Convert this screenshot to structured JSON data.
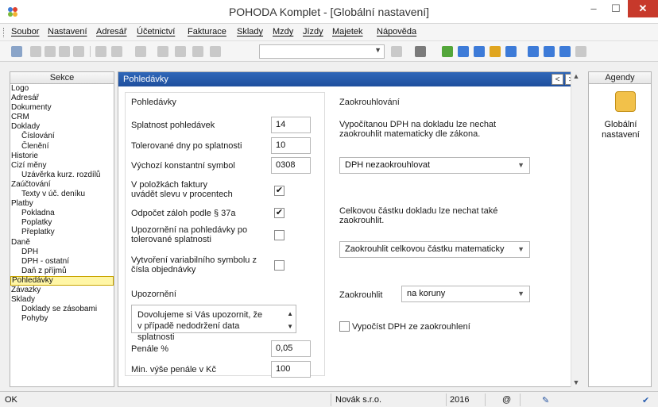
{
  "window": {
    "title": "POHODA Komplet - [Globální nastavení]",
    "minimize": "–",
    "maximize": "☐",
    "close": "✕"
  },
  "menu": [
    "Soubor",
    "Nastavení",
    "Adresář",
    "Účetnictví",
    "Fakturace",
    "Sklady",
    "Mzdy",
    "Jízdy",
    "Majetek",
    "Nápověda"
  ],
  "sections": {
    "header": "Sekce",
    "items": [
      {
        "label": "Logo",
        "level": 1
      },
      {
        "label": "Adresář",
        "level": 1
      },
      {
        "label": "Dokumenty",
        "level": 1
      },
      {
        "label": "CRM",
        "level": 1
      },
      {
        "label": "Doklady",
        "level": 1
      },
      {
        "label": "Číslování",
        "level": 2
      },
      {
        "label": "Členění",
        "level": 2
      },
      {
        "label": "Historie",
        "level": 1
      },
      {
        "label": "Cizí měny",
        "level": 1
      },
      {
        "label": "Uzávěrka kurz. rozdílů",
        "level": 2
      },
      {
        "label": "Zaúčtování",
        "level": 1
      },
      {
        "label": "Texty v úč. deníku",
        "level": 2
      },
      {
        "label": "Platby",
        "level": 1
      },
      {
        "label": "Pokladna",
        "level": 2
      },
      {
        "label": "Poplatky",
        "level": 2
      },
      {
        "label": "Přeplatky",
        "level": 2
      },
      {
        "label": "Daně",
        "level": 1
      },
      {
        "label": "DPH",
        "level": 2
      },
      {
        "label": "DPH - ostatní",
        "level": 2
      },
      {
        "label": "Daň z příjmů",
        "level": 2
      },
      {
        "label": "Pohledávky",
        "level": 1,
        "selected": true
      },
      {
        "label": "Závazky",
        "level": 1
      },
      {
        "label": "Sklady",
        "level": 1
      },
      {
        "label": "Doklady se zásobami",
        "level": 2
      },
      {
        "label": "Pohyby",
        "level": 2
      }
    ]
  },
  "main": {
    "header": "Pohledávky",
    "nav_prev": "<",
    "nav_next": ">",
    "receivables": {
      "title": "Pohledávky",
      "due_label": "Splatnost pohledávek",
      "due_value": "14",
      "tolerance_label": "Tolerované dny po splatnosti",
      "tolerance_value": "10",
      "const_symbol_label": "Výchozí konstantní symbol",
      "const_symbol_value": "0308",
      "discount_pct_label_1": "V položkách faktury",
      "discount_pct_label_2": "uvádět slevu v procentech",
      "discount_pct_checked": "✔",
      "advance_label": "Odpočet záloh podle § 37a",
      "advance_checked": "✔",
      "notify_label_1": "Upozornění na pohledávky po",
      "notify_label_2": "tolerované splatnosti",
      "notify_checked": "",
      "varsym_label_1": "Vytvoření variabilního symbolu z",
      "varsym_label_2": "čísla objednávky",
      "varsym_checked": ""
    },
    "notice": {
      "title": "Upozornění",
      "text_1": "Dovolujeme si Vás upozornit, že",
      "text_2": "v případě nedodržení data splatnosti",
      "penalty_label": "Penále %",
      "penalty_value": "0,05",
      "min_penalty_label": "Min. výše penále v Kč",
      "min_penalty_value": "100"
    },
    "rounding": {
      "title": "Zaokrouhlování",
      "vat_desc_1": "Vypočítanou DPH na dokladu lze nechat",
      "vat_desc_2": "zaokrouhlit matematicky dle zákona.",
      "vat_select": "DPH nezaokrouhlovat",
      "total_desc_1": "Celkovou částku dokladu lze nechat také",
      "total_desc_2": "zaokrouhlit.",
      "total_select": "Zaokrouhlit celkovou částku matematicky",
      "round_label": "Zaokrouhlit",
      "round_select": "na koruny",
      "vat_from_round_label": "Vypočíst DPH ze zaokrouhlení",
      "vat_from_round_checked": ""
    }
  },
  "agendy": {
    "header": "Agendy",
    "item_label_1": "Globální",
    "item_label_2": "nastavení"
  },
  "status": {
    "left": "OK",
    "company": "Novák s.r.o.",
    "year": "2016"
  },
  "colors": {
    "header_blue": "#2a5fb0",
    "selected_yellow": "#fff6a6",
    "close_red": "#c7392b"
  }
}
